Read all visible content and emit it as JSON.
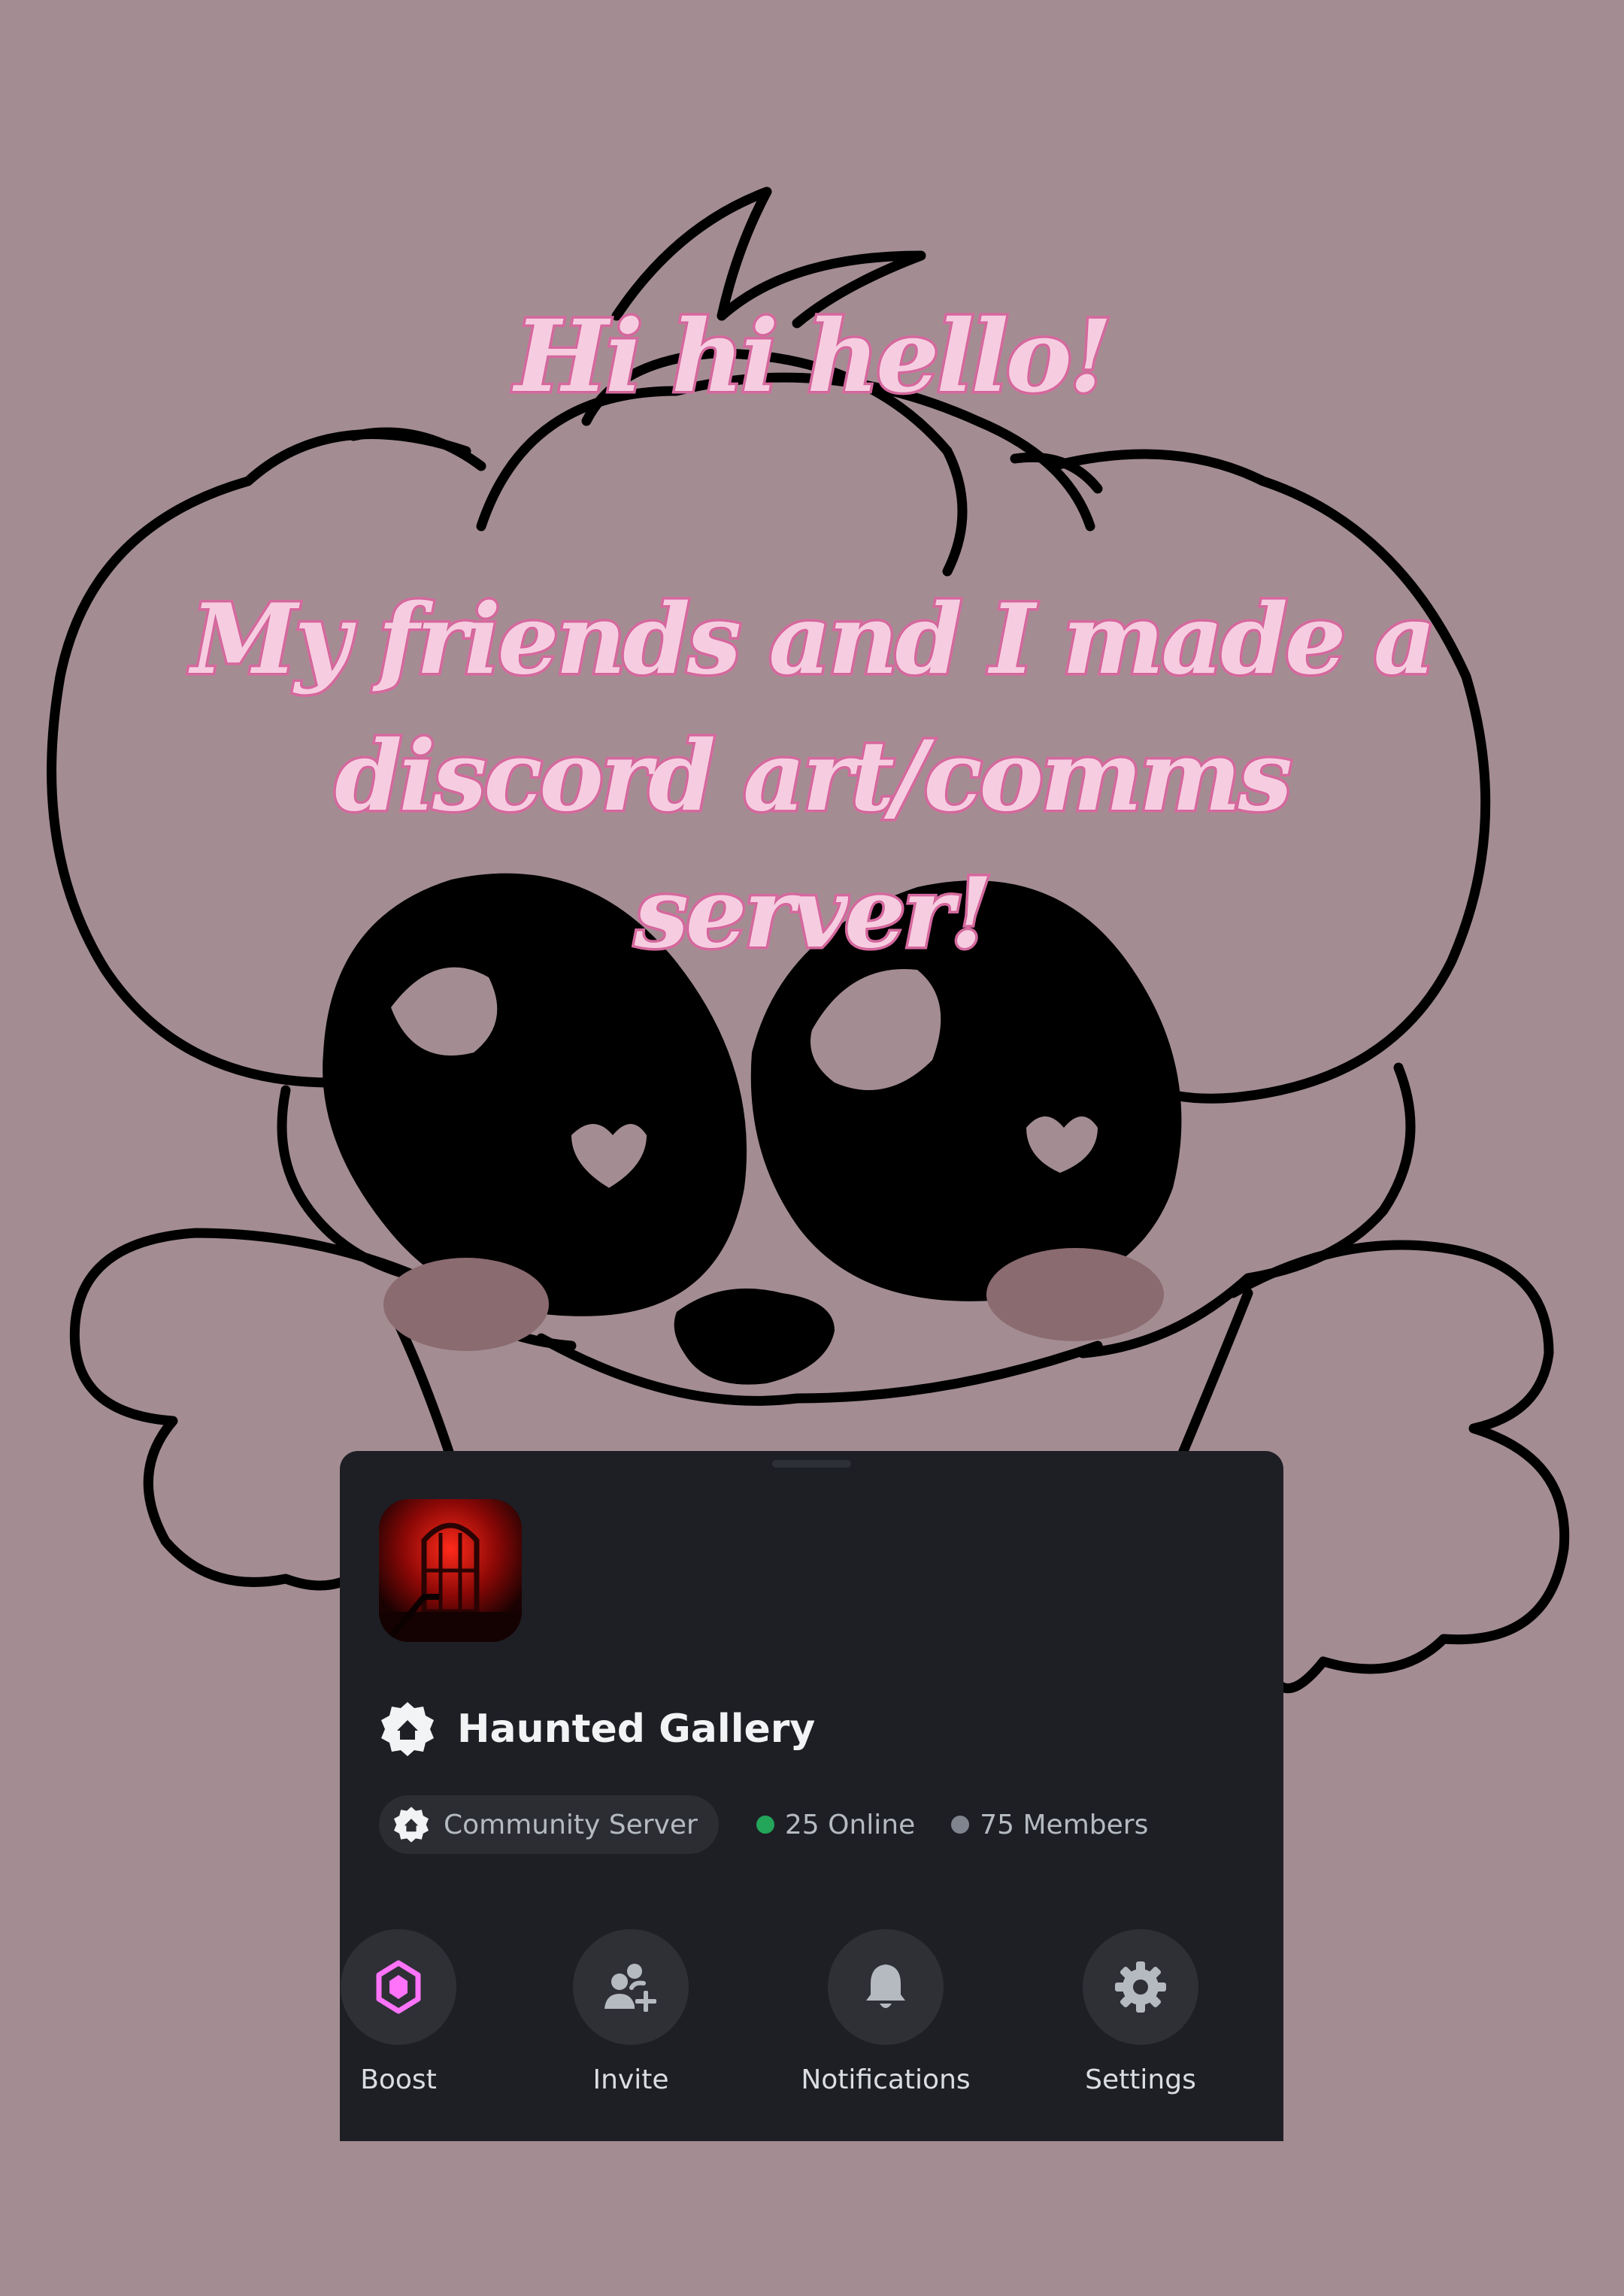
{
  "banner": {
    "greeting": "Hi hi hello!",
    "message": "My friends and I made a discord art/comms server!"
  },
  "server_card": {
    "name": "Haunted Gallery",
    "community_label": "Community Server",
    "online_text": "25 Online",
    "members_text": "75 Members",
    "actions": [
      {
        "label": "Boost",
        "icon": "boost-gem-icon"
      },
      {
        "label": "Invite",
        "icon": "add-person-icon"
      },
      {
        "label": "Notifications",
        "icon": "bell-icon"
      },
      {
        "label": "Settings",
        "icon": "gear-icon"
      }
    ]
  },
  "colors": {
    "background": "#a38d92",
    "card": "#1e1f25",
    "online_dot": "#23a55a",
    "members_dot": "#80848e",
    "boost_accent": "#ff73fa",
    "headline_fill": "#f6cde0",
    "headline_stroke": "#d66a9f"
  }
}
